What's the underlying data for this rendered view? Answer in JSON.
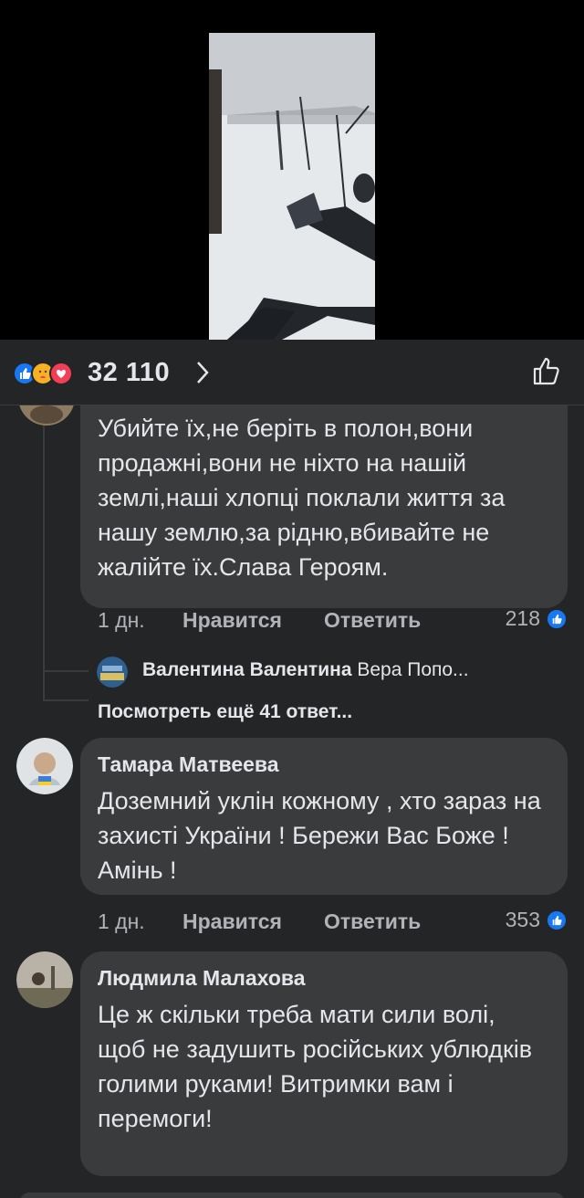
{
  "reactions": {
    "count": "32 110",
    "icons": [
      "like-icon",
      "care-icon",
      "love-icon"
    ]
  },
  "comments": [
    {
      "author": "",
      "text": "Убийте їх,не беріть в полон,вони продажні,вони не ніхто на нашій землі,наші хлопці поклали життя за нашу землю,за рідню,вбивайте не жалійте їх.Слава Героям.",
      "time": "1 дн.",
      "like_label": "Нравится",
      "reply_label": "Ответить",
      "likes": "218",
      "reply_preview": {
        "author": "Валентина Валентина",
        "text": "Вера Попо..."
      },
      "more_replies": "Посмотреть ещё 41 ответ..."
    },
    {
      "author": "Тамара Матвеева",
      "text": "Доземний уклін  кожному , хто зараз на захисті України ! Бережи Вас Боже ! Амінь !",
      "time": "1 дн.",
      "like_label": "Нравится",
      "reply_label": "Ответить",
      "likes": "353"
    },
    {
      "author": "Людмила Малахова",
      "text": "Це ж скільки треба мати сили волі, щоб не задушить російських ублюдків голими руками! Витримки вам і перемоги!"
    }
  ],
  "colors": {
    "panel": "#242526",
    "bubble": "#3a3b3c",
    "accent": "#1877f2",
    "text": "#e4e6eb",
    "muted": "#b0b3b8"
  }
}
